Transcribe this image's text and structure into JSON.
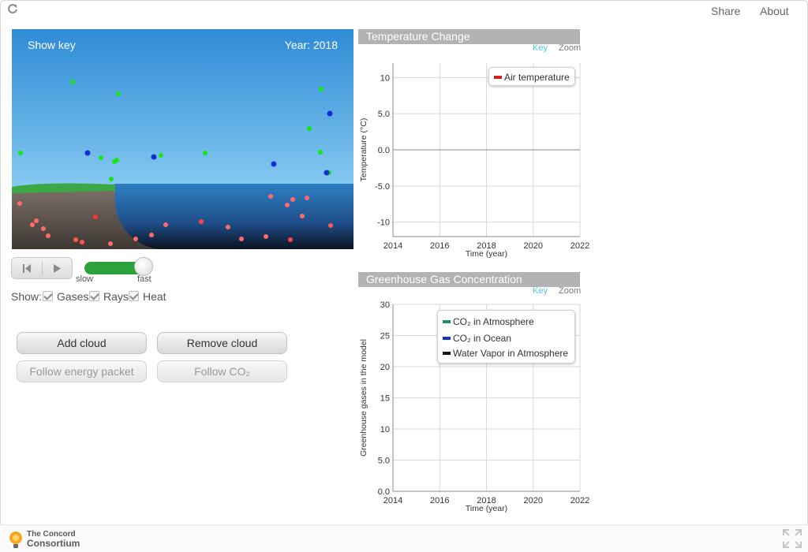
{
  "topbar": {
    "share_label": "Share",
    "about_label": "About"
  },
  "footer": {
    "logo_line1": "The Concord",
    "logo_line2": "Consortium"
  },
  "sim": {
    "show_key_label": "Show key",
    "year_label": "Year: 2018"
  },
  "controls": {
    "speed_slow_label": "slow",
    "speed_fast_label": "fast",
    "speed_level": 0.9,
    "show_label": "Show:",
    "gases_label": "Gases",
    "rays_label": "Rays",
    "heat_label": "Heat",
    "gases_checked": true,
    "rays_checked": true,
    "heat_checked": true
  },
  "buttons": {
    "add_cloud": "Add cloud",
    "remove_cloud": "Remove cloud",
    "follow_energy": "Follow energy packet",
    "follow_co2": "Follow CO₂"
  },
  "temperature_graph": {
    "title": "Temperature Change",
    "key_label": "Key",
    "zoom_label": "Zoom",
    "ylabel": "Temperature (°C)",
    "xlabel": "Time (year)",
    "legend": [
      {
        "label": "Air temperature",
        "color": "#d22020"
      }
    ]
  },
  "ghg_graph": {
    "title": "Greenhouse Gas Concentration",
    "key_label": "Key",
    "zoom_label": "Zoom",
    "ylabel": "Greenhouse gases in the model",
    "xlabel": "Time (year)",
    "legend": [
      {
        "label": "CO₂ in Atmosphere",
        "color": "#1a8f6a"
      },
      {
        "label": "CO₂ in Ocean",
        "color": "#1030d0"
      },
      {
        "label": "Water Vapor in Atmosphere",
        "color": "#111111"
      }
    ]
  },
  "chart_data": [
    {
      "type": "line",
      "title": "Temperature Change",
      "xlabel": "Time (year)",
      "ylabel": "Temperature (°C)",
      "xlim": [
        2014,
        2022
      ],
      "ylim": [
        -12,
        12
      ],
      "x_ticks": [
        2014,
        2016,
        2018,
        2020,
        2022
      ],
      "y_ticks": [
        10,
        5.0,
        0.0,
        -5.0,
        -10
      ],
      "y_tick_labels": [
        "10",
        "5.0",
        "0.0",
        "-5.0",
        "-10"
      ],
      "grid": true,
      "legend_position": "top-right",
      "series": [
        {
          "name": "Air temperature",
          "color": "#d22020",
          "x": [],
          "y": []
        }
      ]
    },
    {
      "type": "line",
      "title": "Greenhouse Gas Concentration",
      "xlabel": "Time (year)",
      "ylabel": "Greenhouse gases in the model",
      "xlim": [
        2014,
        2022
      ],
      "ylim": [
        0,
        30
      ],
      "x_ticks": [
        2014,
        2016,
        2018,
        2020,
        2022
      ],
      "y_ticks": [
        30,
        25,
        20,
        15,
        10,
        5.0,
        0.0
      ],
      "y_tick_labels": [
        "30",
        "25",
        "20",
        "15",
        "10",
        "5.0",
        "0.0"
      ],
      "grid": true,
      "legend_position": "top-right",
      "series": [
        {
          "name": "CO₂ in Atmosphere",
          "color": "#1a8f6a",
          "x": [],
          "y": []
        },
        {
          "name": "CO₂ in Ocean",
          "color": "#1030d0",
          "x": [],
          "y": []
        },
        {
          "name": "Water Vapor in Atmosphere",
          "color": "#111111",
          "x": [],
          "y": []
        }
      ]
    }
  ]
}
